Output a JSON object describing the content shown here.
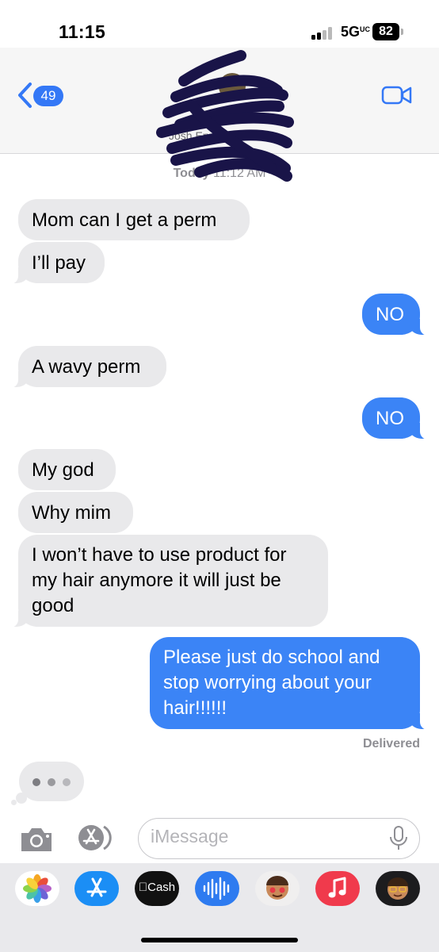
{
  "status_bar": {
    "time": "11:15",
    "network": "5G",
    "battery": "82"
  },
  "header": {
    "back_badge_count": "49",
    "contact_name": "Josh Ervins",
    "contact_chevron": ">"
  },
  "timestamp": {
    "day": "Today",
    "time": "11:12 AM"
  },
  "messages": [
    {
      "direction": "incoming",
      "text": "Mom can I get a perm"
    },
    {
      "direction": "incoming",
      "text": "I’ll pay"
    },
    {
      "direction": "outgoing",
      "text": "NO"
    },
    {
      "direction": "incoming",
      "text": "A wavy perm"
    },
    {
      "direction": "outgoing",
      "text": "NO"
    },
    {
      "direction": "incoming",
      "text": "My god"
    },
    {
      "direction": "incoming",
      "text": "Why mim"
    },
    {
      "direction": "incoming",
      "text": "I won’t have to use product for my hair anymore it will just be good"
    },
    {
      "direction": "outgoing",
      "text": "Please just do school and stop worrying about your hair!!!!!!"
    }
  ],
  "delivery_status": "Delivered",
  "input": {
    "placeholder": "iMessage"
  },
  "apps": [
    {
      "name": "photos-app",
      "icon": "photos-icon"
    },
    {
      "name": "app-store-app",
      "icon": "app-store-icon"
    },
    {
      "name": "cash-app",
      "icon": "cash-icon",
      "label": "Cash"
    },
    {
      "name": "audio-message-app",
      "icon": "waveform-icon"
    },
    {
      "name": "memoji-stickers-app",
      "icon": "memoji-stickers-icon"
    },
    {
      "name": "music-app",
      "icon": "music-note-icon"
    },
    {
      "name": "memoji-app",
      "icon": "memoji-icon"
    }
  ],
  "colors": {
    "accent": "#3478f6",
    "outgoing_bubble": "#3b84f6",
    "incoming_bubble": "#e9e9eb",
    "secondary_text": "#8e8e93"
  }
}
